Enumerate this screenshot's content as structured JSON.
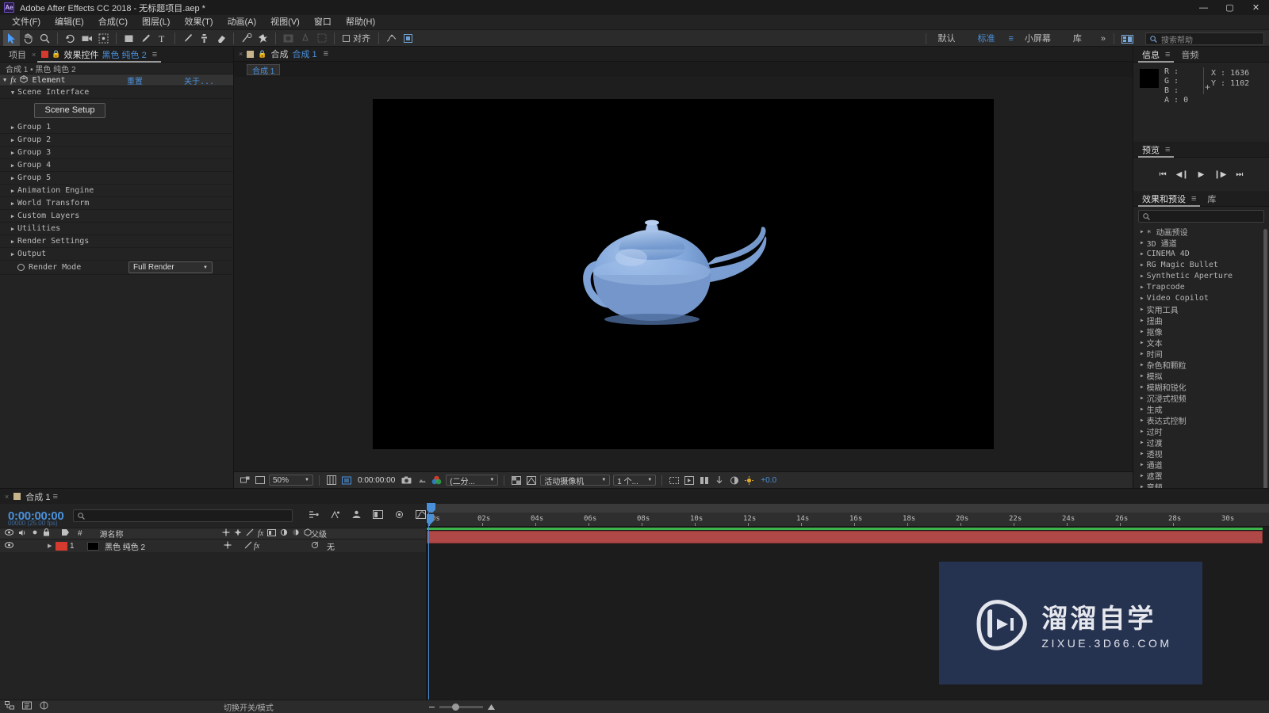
{
  "titlebar": {
    "logo": "Ae",
    "title": "Adobe After Effects CC 2018 - 无标题项目.aep *",
    "minimize": "—",
    "maximize": "▢",
    "close": "✕"
  },
  "menubar": {
    "items": [
      "文件(F)",
      "编辑(E)",
      "合成(C)",
      "图层(L)",
      "效果(T)",
      "动画(A)",
      "视图(V)",
      "窗口",
      "帮助(H)"
    ]
  },
  "toolbar": {
    "align_label": "对齐",
    "workspaces": [
      {
        "label": "默认",
        "selected": false
      },
      {
        "label": "标准",
        "selected": true
      },
      {
        "label": "小屏幕",
        "selected": false
      },
      {
        "label": "库",
        "selected": false
      }
    ],
    "overflow": "»",
    "search_placeholder": "搜索帮助",
    "search_icon": "search-icon"
  },
  "effect_controls": {
    "tab_project": "项目",
    "tab_effect_controls": "效果控件",
    "tab_layer_name": "黑色 纯色 2",
    "breadcrumb": "合成 1 • 黑色 纯色 2",
    "effect_name": "Element",
    "reset_label": "重置",
    "about_label": "关于...",
    "scene_interface": "Scene Interface",
    "scene_setup_button": "Scene Setup",
    "groups": [
      "Group 1",
      "Group 2",
      "Group 3",
      "Group 4",
      "Group 5",
      "Animation Engine",
      "World Transform",
      "Custom Layers",
      "Utilities",
      "Render Settings",
      "Output"
    ],
    "render_mode_label": "Render Mode",
    "render_mode_value": "Full Render"
  },
  "composition": {
    "tab_label": "合成",
    "comp_name": "合成 1",
    "sub_tab": "合成 1"
  },
  "viewer_toolbar": {
    "zoom": "50%",
    "timecode": "0:00:00:00",
    "resolution": "(二分...",
    "camera": "活动摄像机",
    "views": "1 个...",
    "exposure": "+0.0"
  },
  "info_panel": {
    "tab_info": "信息",
    "tab_audio": "音频",
    "r_label": "R :",
    "g_label": "G :",
    "b_label": "B :",
    "a_label": "A : 0",
    "x_value": "X : 1636",
    "y_value": "Y : 1102"
  },
  "preview_panel": {
    "tab_label": "预览",
    "buttons": [
      "⏮",
      "◀❙",
      "▶",
      "❙▶",
      "⏭"
    ]
  },
  "effects_presets": {
    "tab_label": "效果和预设",
    "tab_library": "库",
    "search_placeholder": "",
    "items": [
      "* 动画预设",
      "3D 通道",
      "CINEMA 4D",
      "RG Magic Bullet",
      "Synthetic Aperture",
      "Trapcode",
      "Video Copilot",
      "实用工具",
      "扭曲",
      "抠像",
      "文本",
      "时间",
      "杂色和颗粒",
      "模拟",
      "模糊和锐化",
      "沉浸式视频",
      "生成",
      "表达式控制",
      "过时",
      "过渡",
      "透视",
      "通道",
      "遮罩",
      "音频"
    ]
  },
  "timeline": {
    "tab_label": "合成 1",
    "timecode": "0:00:00:00",
    "frames": "00000 (25.00 fps)",
    "search_placeholder": "",
    "columns": {
      "source_name": "源名称",
      "parent": "父级"
    },
    "layers": [
      {
        "index": "1",
        "name": "黑色 纯色 2",
        "parent": "无",
        "color": "#d43b2e"
      }
    ],
    "ruler_ticks": [
      "0s",
      "02s",
      "04s",
      "06s",
      "08s",
      "10s",
      "12s",
      "14s",
      "16s",
      "18s",
      "20s",
      "22s",
      "24s",
      "26s",
      "28s",
      "30s"
    ],
    "bottom_label": "切换开关/模式"
  },
  "watermark": {
    "cn": "溜溜自学",
    "en": "ZIXUE.3D66.COM"
  },
  "colors": {
    "accent_blue": "#4a90d9",
    "layer_red": "#b04848",
    "work_green": "#3bb54a",
    "watermark_bg": "#253250"
  }
}
